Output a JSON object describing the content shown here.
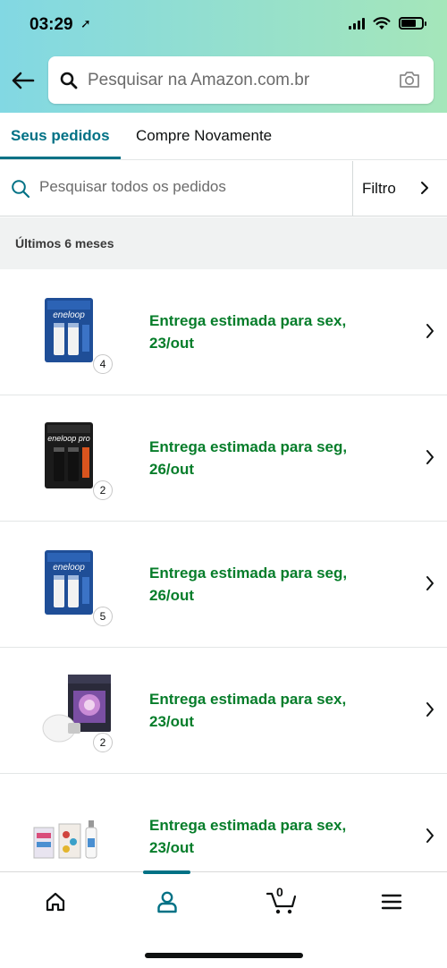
{
  "status_bar": {
    "time": "03:29"
  },
  "header": {
    "search_placeholder": "Pesquisar na Amazon.com.br"
  },
  "tabs": [
    {
      "label": "Seus pedidos",
      "active": true
    },
    {
      "label": "Compre Novamente",
      "active": false
    }
  ],
  "orders_search": {
    "placeholder": "Pesquisar todos os pedidos",
    "filter_label": "Filtro"
  },
  "section_title": "Últimos 6 meses",
  "orders": [
    {
      "status_line1": "Entrega estimada para sex,",
      "status_line2": "23/out",
      "quantity": "4",
      "image": "eneloop-aa-blue-pack"
    },
    {
      "status_line1": "Entrega estimada para seg,",
      "status_line2": "26/out",
      "quantity": "2",
      "image": "eneloop-pro-black-pack"
    },
    {
      "status_line1": "Entrega estimada para seg,",
      "status_line2": "26/out",
      "quantity": "5",
      "image": "eneloop-aa-blue-pack"
    },
    {
      "status_line1": "Entrega estimada para sex,",
      "status_line2": "23/out",
      "quantity": "2",
      "image": "philips-hue-bulb-box"
    },
    {
      "status_line1": "Entrega estimada para sex,",
      "status_line2": "23/out",
      "quantity": "",
      "image": "small-bottles-set"
    }
  ],
  "bottom_nav": {
    "cart_count": "0",
    "active_item": "account"
  },
  "colors": {
    "accent": "#007185",
    "status_green": "#067d2a",
    "header_start": "#82d8e3",
    "header_end": "#a5e6ba"
  }
}
